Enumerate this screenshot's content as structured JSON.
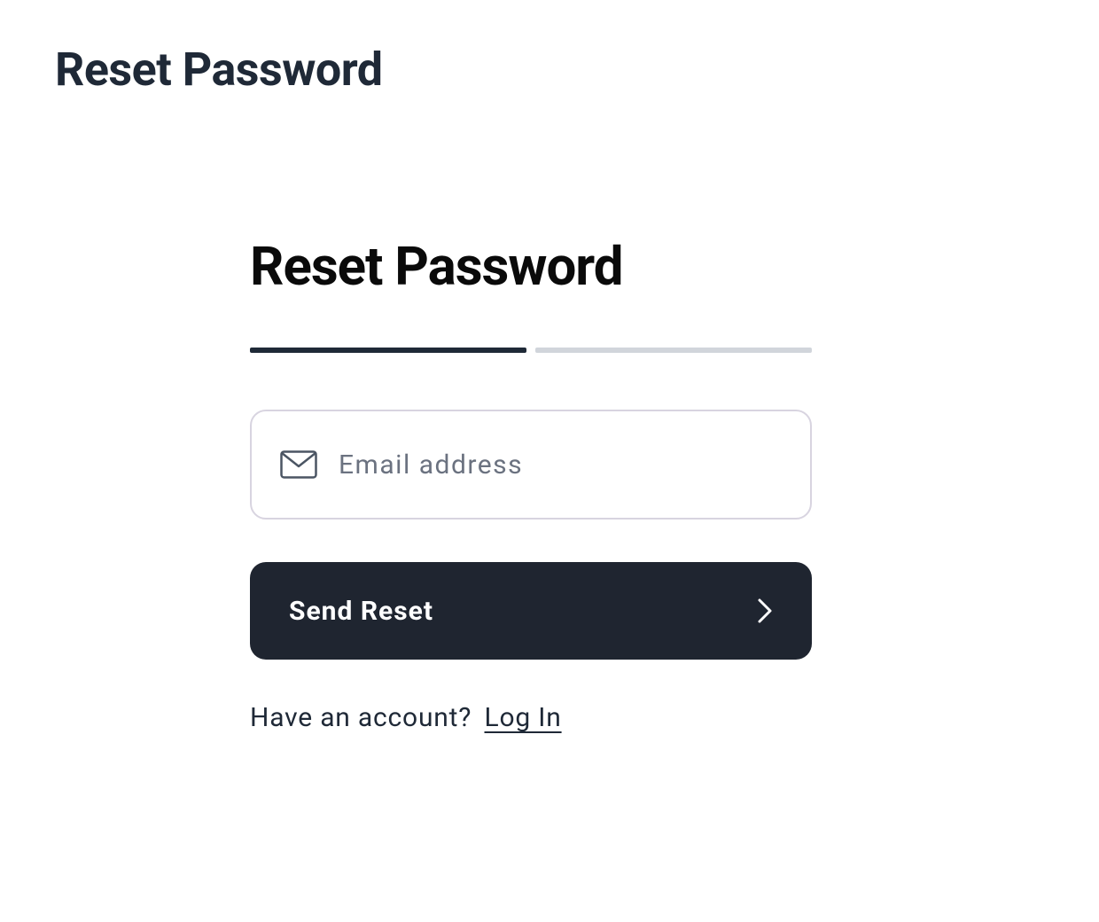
{
  "page": {
    "title": "Reset Password"
  },
  "form": {
    "title": "Reset Password",
    "progress": {
      "total": 2,
      "active": 1
    },
    "email": {
      "placeholder": "Email address",
      "value": ""
    },
    "submit_label": "Send Reset",
    "footer": {
      "prompt": "Have an account? ",
      "link_label": "Log In"
    }
  }
}
